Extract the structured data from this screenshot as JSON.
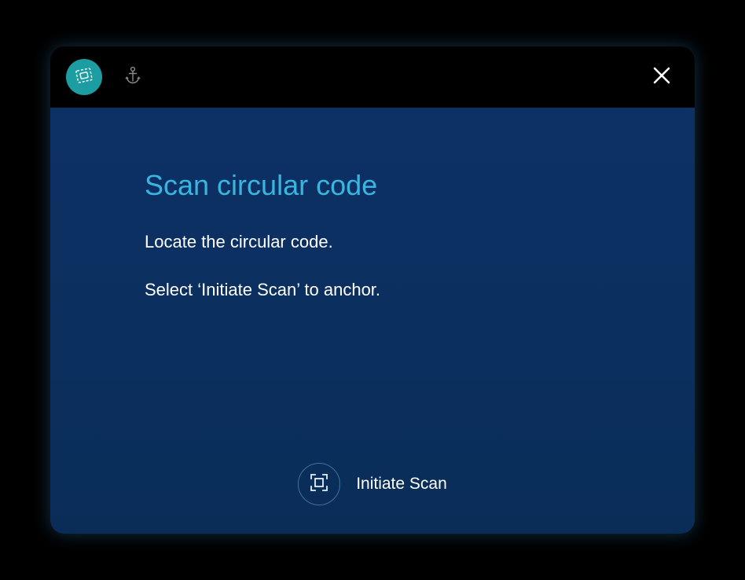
{
  "topbar": {
    "tabs": [
      {
        "name": "scan-tab",
        "icon": "chip-icon",
        "active": true
      },
      {
        "name": "anchor-tab",
        "icon": "anchor-icon",
        "active": false
      }
    ],
    "close_label": "Close"
  },
  "main": {
    "title": "Scan circular code",
    "line1": "Locate the circular code.",
    "line2": "Select ‘Initiate Scan’ to anchor."
  },
  "action": {
    "label": "Initiate Scan",
    "icon": "scan-frame-icon"
  },
  "colors": {
    "accent": "#1b9da2",
    "title": "#39b6df",
    "panel": "#0c3165"
  }
}
